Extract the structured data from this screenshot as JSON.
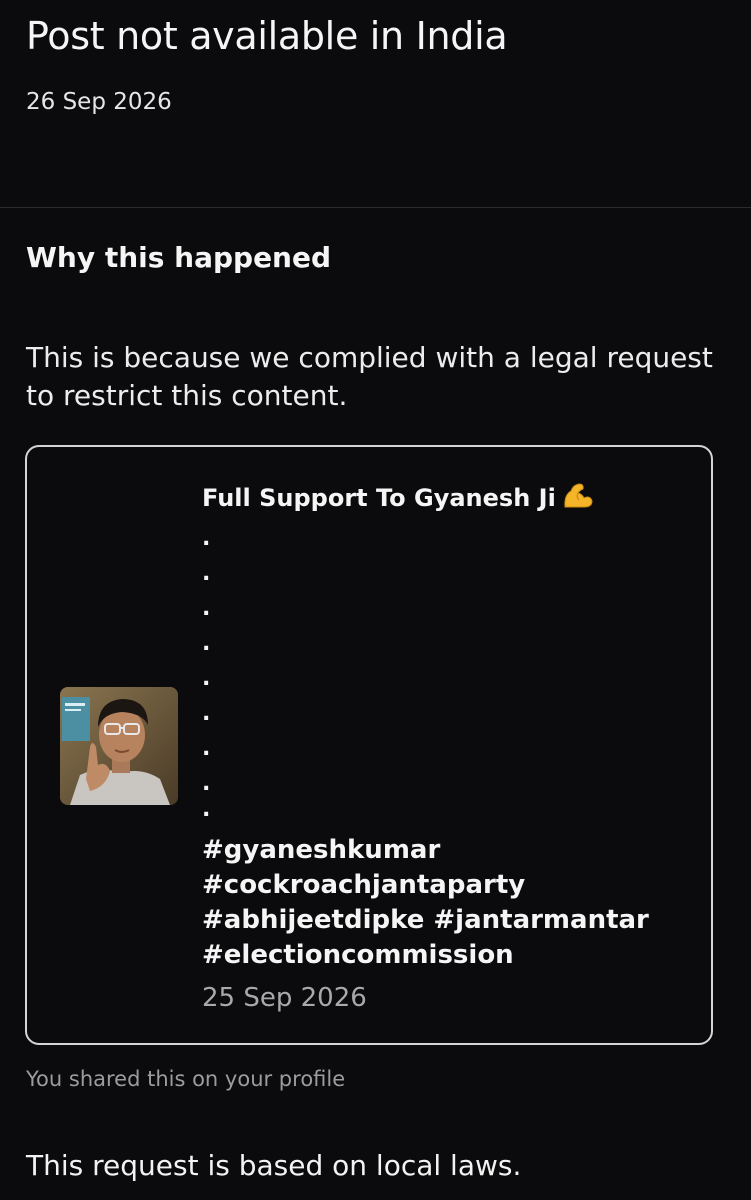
{
  "notice": {
    "title": "Post not available in India",
    "date": "26 Sep 2026"
  },
  "reason": {
    "heading": "Why this happened",
    "explanation": "This is because we complied with a legal request to restrict this content."
  },
  "post": {
    "caption": "Full Support To Gyanesh Ji",
    "caption_emoji_icon": "flexed-biceps-icon",
    "dots": [
      ".",
      ".",
      ".",
      ".",
      ".",
      ".",
      ".",
      ".",
      "."
    ],
    "hashtags": "#gyaneshkumar\n#cockroachjantaparty\n#abhijeetdipke #jantarmantar\n#electioncommission",
    "date": "25 Sep 2026",
    "thumbnail": "video-thumbnail"
  },
  "shared_note": "You shared this on your profile",
  "footer_text": "This request is based on local laws.",
  "colors": {
    "background": "#0b0b0d",
    "text": "#f2f2f2",
    "muted": "#9c9c9c",
    "card_border": "#d4d4d4"
  }
}
